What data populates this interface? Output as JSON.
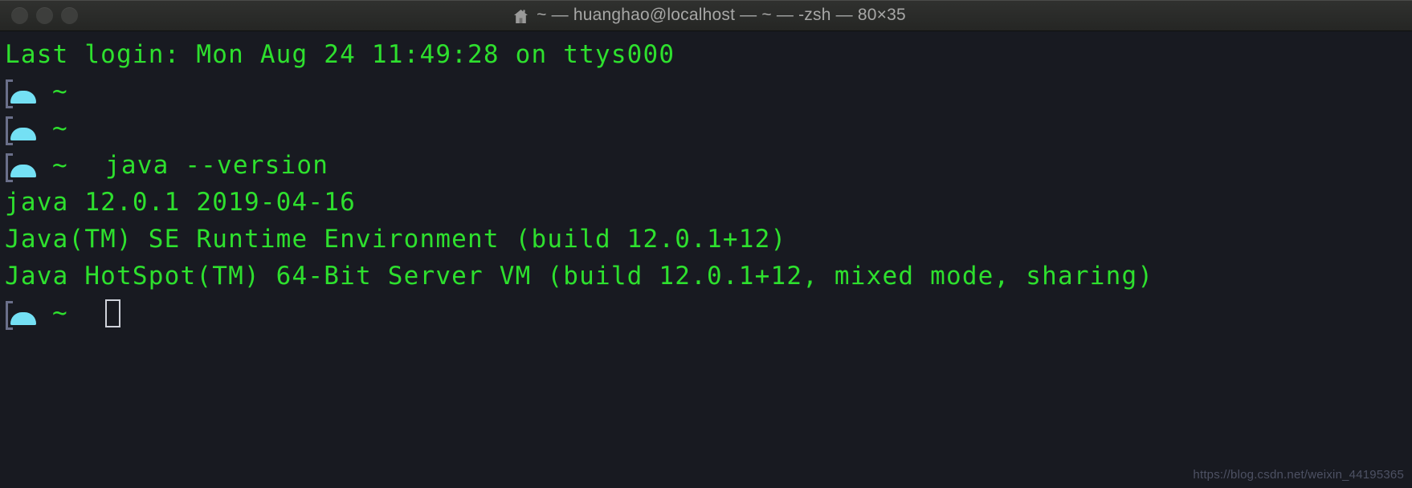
{
  "window": {
    "title": "~ — huanghao@localhost — ~ — -zsh — 80×35",
    "home_icon": "home-icon",
    "traffic_lights": [
      "close-button",
      "minimize-button",
      "zoom-button"
    ],
    "size_label": "80×35",
    "shell": "-zsh",
    "user_host": "huanghao@localhost",
    "cwd": "~"
  },
  "colors": {
    "titlebar_bg": "#2a2b29",
    "titlebar_text": "#a7a7a6",
    "terminal_bg": "#181a21",
    "terminal_green": "#2ee02e",
    "prompt_cyan": "#74e0f4",
    "prompt_bracket": "#6a6f8a",
    "cursor": "#cfd2da",
    "watermark": "#4d5163"
  },
  "terminal": {
    "login_line": "Last login: Mon Aug 24 11:49:28 on ttys000",
    "prompt_symbol": "~",
    "prompt_icon": "cloud-icon",
    "command": "java --version",
    "output": [
      "java 12.0.1 2019-04-16",
      "Java(TM) SE Runtime Environment (build 12.0.1+12)",
      "Java HotSpot(TM) 64-Bit Server VM (build 12.0.1+12, mixed mode, sharing)"
    ],
    "cursor": "cursor-block"
  },
  "watermark": "https://blog.csdn.net/weixin_44195365"
}
